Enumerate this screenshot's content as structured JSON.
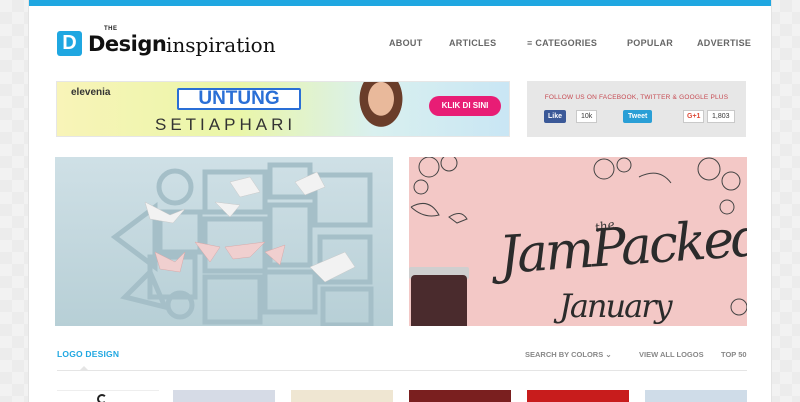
{
  "logo": {
    "mark": "D",
    "the": "THE",
    "design": "Design",
    "inspiration": "inspiration"
  },
  "nav": {
    "items": [
      {
        "label": "ABOUT"
      },
      {
        "label": "ARTICLES"
      },
      {
        "label": "≡ CATEGORIES"
      },
      {
        "label": "POPULAR"
      },
      {
        "label": "ADVERTISE"
      }
    ]
  },
  "ad": {
    "brand": "elevenia",
    "title": "UNTUNG",
    "subtitle": "SETIAPHARI",
    "cta": "KLIK DI SINI"
  },
  "social": {
    "title": "FOLLOW US ON FACEBOOK, TWITTER & GOOGLE PLUS",
    "like_label": "Like",
    "like_count": "10k",
    "tweet_label": "Tweet",
    "gplus_label": "G+1",
    "gplus_count": "1,803"
  },
  "feature_right": {
    "the": "the",
    "jam": "JamPacked",
    "january": "January"
  },
  "section": {
    "title": "LOGO DESIGN",
    "search_by_colors": "SEARCH BY COLORS",
    "view_all": "VIEW ALL LOGOS",
    "top": "TOP 50"
  },
  "colors": {
    "accent": "#1fa7e1",
    "social_title": "#c64a52",
    "facebook": "#3b5998",
    "twitter": "#2a9fd6",
    "ad_cta": "#e81d75"
  }
}
